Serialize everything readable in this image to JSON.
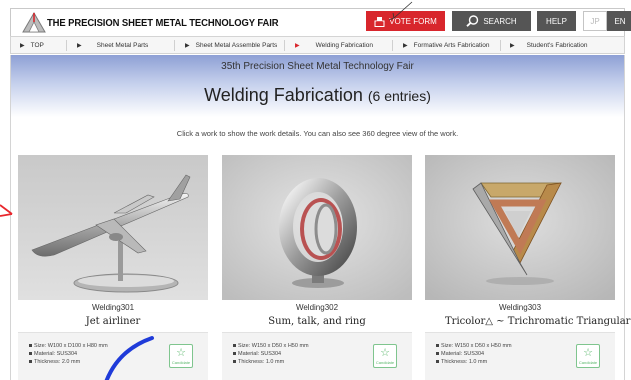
{
  "header": {
    "site_title": "THE PRECISION SHEET METAL TECHNOLOGY FAIR",
    "vote_label": "VOTE FORM",
    "search_label": "SEARCH",
    "help_label": "HELP",
    "lang_jp": "JP",
    "lang_en": "EN"
  },
  "nav": {
    "items": [
      {
        "label": "TOP",
        "active": false
      },
      {
        "label": "Sheet Metal Parts",
        "active": false
      },
      {
        "label": "Sheet Metal Assemble Parts",
        "active": false
      },
      {
        "label": "Welding Fabrication",
        "active": true
      },
      {
        "label": "Formative Arts Fabrication",
        "active": false
      },
      {
        "label": "Student's Fabrication",
        "active": false
      }
    ]
  },
  "hero": {
    "subtitle": "35th Precision Sheet Metal Technology Fair",
    "title": "Welding Fabrication",
    "count": "(6 entries)"
  },
  "instructions": "Click a work to show the work details. You can also see 360 degree view of the work.",
  "works": [
    {
      "code": "Welding301",
      "name": "Jet airliner",
      "size": "Size: W100 x D100 x H80 mm",
      "material": "Material: SUS304",
      "thickness": "Thickness: 2.0 mm",
      "candidate_label": "Candidate",
      "icon": "airplane-model"
    },
    {
      "code": "Welding302",
      "name": "Sum, talk, and ring",
      "size": "Size: W150 x D50 x H50 mm",
      "material": "Material: SUS304",
      "thickness": "Thickness: 1.0 mm",
      "candidate_label": "Candidate",
      "icon": "ring-sculpture"
    },
    {
      "code": "Welding303",
      "name": "Tricolor△ ~ Trichromatic Triangular Bule",
      "size": "Size: W150 x D50 x H50 mm",
      "material": "Material: SUS304",
      "thickness": "Thickness: 1.0 mm",
      "candidate_label": "Candidate",
      "icon": "penrose-triangle"
    }
  ],
  "colors": {
    "vote_red": "#d8262c",
    "header_gray": "#555555",
    "candidate_green": "#5cb86d",
    "annotation_red": "#e8262c",
    "annotation_blue": "#1f3bd9"
  }
}
